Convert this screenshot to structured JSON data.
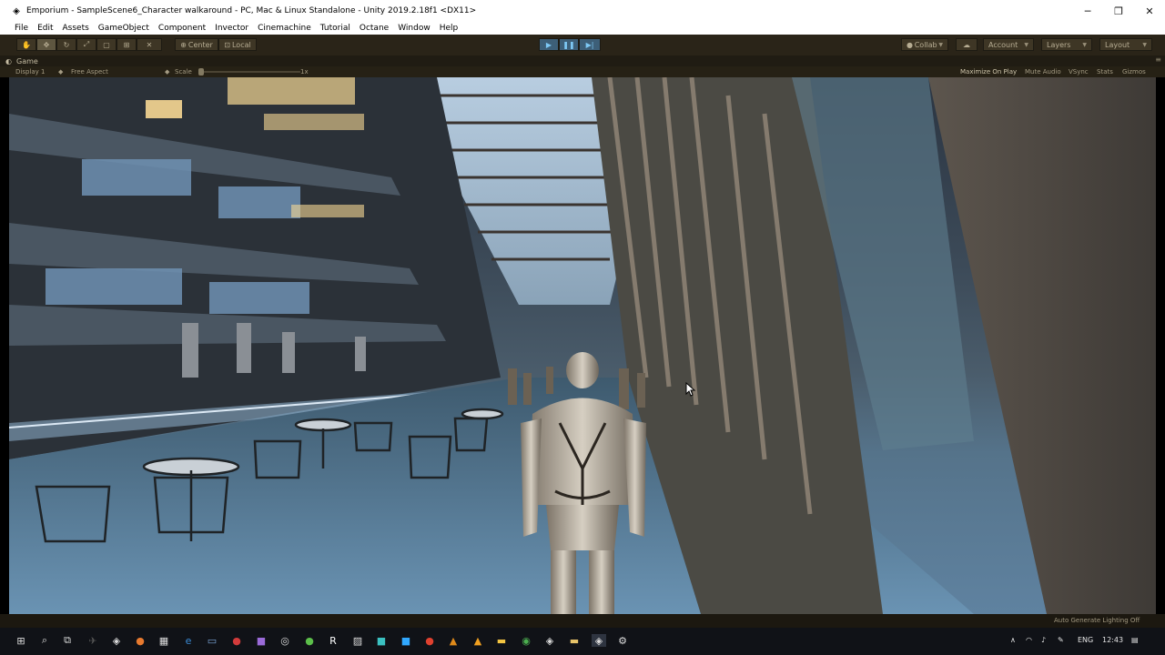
{
  "window": {
    "title": "Emporium - SampleScene6_Character walkaround - PC, Mac & Linux Standalone - Unity 2019.2.18f1 <DX11>",
    "app_icon": "unity-icon",
    "minimize": "─",
    "maximize": "❐",
    "close": "✕"
  },
  "menu": [
    "File",
    "Edit",
    "Assets",
    "GameObject",
    "Component",
    "Invector",
    "Cinemachine",
    "Tutorial",
    "Octane",
    "Window",
    "Help"
  ],
  "toolbar": {
    "pivot": "Center",
    "space": "Local",
    "collab": "Collab",
    "account": "Account",
    "layers": "Layers",
    "layout": "Layout"
  },
  "game_tab": {
    "label": "Game",
    "display": "Display 1",
    "aspect": "Free Aspect",
    "scale_label": "Scale",
    "scale_value": "1x",
    "scale_fraction": 0,
    "maximize_on_play": "Maximize On Play",
    "mute_audio": "Mute Audio",
    "vsync": "VSync",
    "stats": "Stats",
    "gizmos": "Gizmos"
  },
  "status": {
    "lighting": "Auto Generate Lighting Off"
  },
  "taskbar": {
    "language": "ENG",
    "time": "12:43"
  },
  "colors": {
    "toolbar_bg": "#2a2418",
    "play_accent": "#7ec9f5",
    "taskbar_bg": "#101217"
  }
}
